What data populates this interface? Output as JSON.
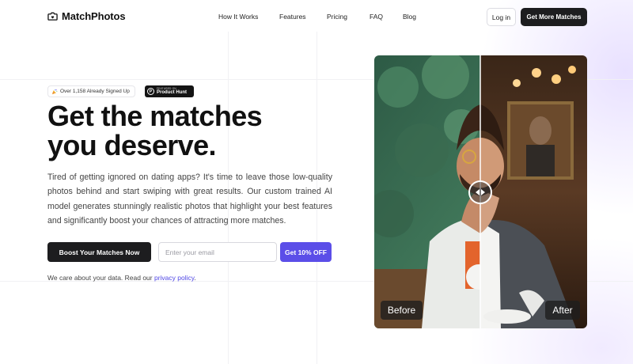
{
  "brand": {
    "name": "MatchPhotos"
  },
  "nav": {
    "links": [
      "How It Works",
      "Features",
      "Pricing",
      "FAQ",
      "Blog"
    ],
    "login_label": "Log in",
    "cta_label": "Get More Matches"
  },
  "badges": {
    "signed_up": "Over 1,158 Already Signed Up",
    "product_hunt_top": "FEATURED ON",
    "product_hunt": "Product Hunt",
    "product_hunt_letter": "P"
  },
  "hero": {
    "title_line1": "Get the matches",
    "title_line2": "you deserve.",
    "description": "Tired of getting ignored on dating apps? It's time to leave those low-quality photos behind and start swiping with great results. Our custom trained AI model generates stunningly realistic photos that highlight your best features and significantly boost your chances of attracting more matches."
  },
  "cta": {
    "primary_label": "Boost Your Matches Now",
    "email_placeholder": "Enter your email",
    "email_value": "",
    "discount_label": "Get 10% OFF"
  },
  "privacy": {
    "text": "We care about your data. Read our ",
    "link": "privacy policy",
    "suffix": "."
  },
  "compare": {
    "before_label": "Before",
    "after_label": "After",
    "slider_position_percent": 50
  },
  "colors": {
    "accent": "#5b4ee8",
    "dark_button": "#1d1d1f",
    "link": "#4f46e5"
  },
  "icons": {
    "logo": "camera-heart-icon",
    "signed_up": "party-popper-icon",
    "slider": "arrows-left-right-icon"
  }
}
